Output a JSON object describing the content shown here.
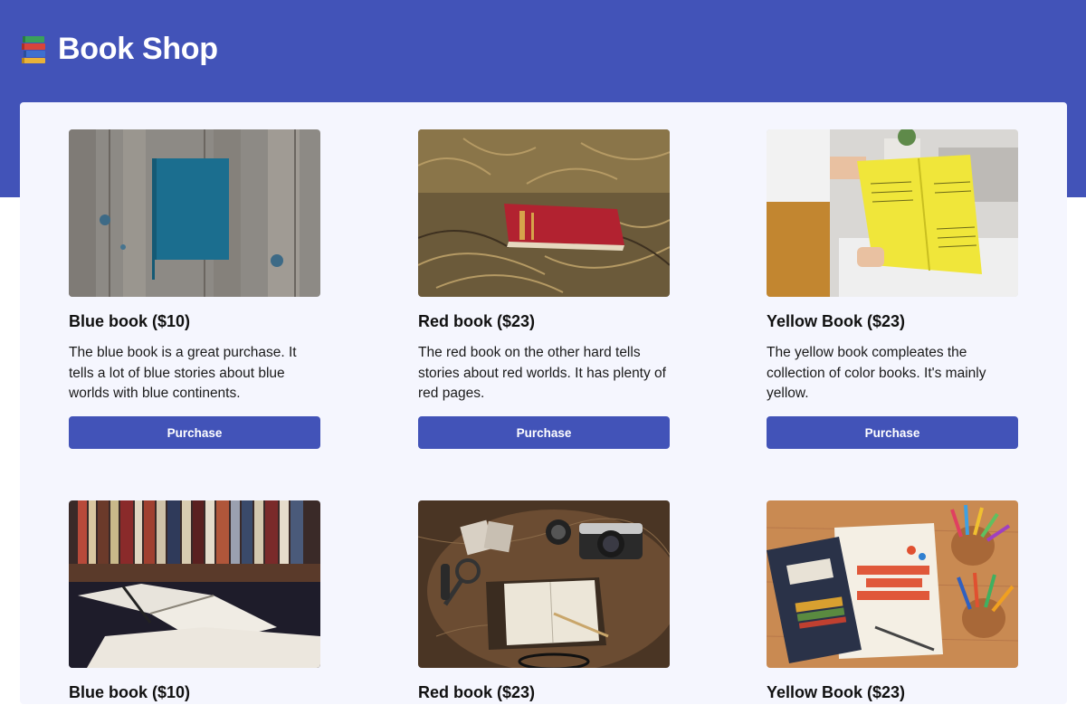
{
  "header": {
    "title": "Book Shop",
    "icon": "books-icon",
    "color": "#4253b8"
  },
  "products": [
    {
      "title": "Blue book ($10)",
      "description": "The blue book is a great purchase. It tells a lot of blue stories about blue worlds with blue continents.",
      "button": "Purchase",
      "image": "blue-book-on-wood-image"
    },
    {
      "title": "Red book ($23)",
      "description": "The red book on the other hard tells stories about red worlds. It has plenty of red pages.",
      "button": "Purchase",
      "image": "red-book-in-grass-image"
    },
    {
      "title": "Yellow Book ($23)",
      "description": "The yellow book compleates the collection of color books. It's mainly yellow.",
      "button": "Purchase",
      "image": "yellow-book-reader-image"
    },
    {
      "title": "Blue book ($10)",
      "image": "open-book-library-image"
    },
    {
      "title": "Red book ($23)",
      "image": "travel-notebook-camera-image"
    },
    {
      "title": "Yellow Book ($23)",
      "image": "maths-activities-book-image"
    }
  ]
}
